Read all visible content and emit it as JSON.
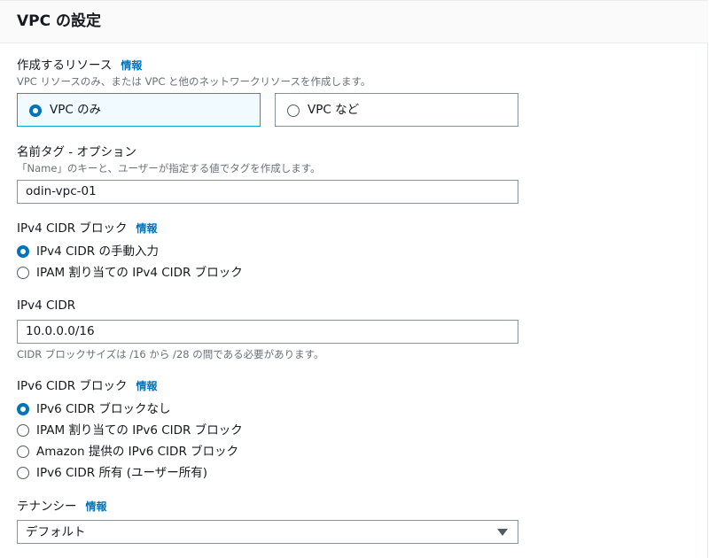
{
  "header": {
    "title": "VPC の設定"
  },
  "resources": {
    "label": "作成するリソース",
    "info": "情報",
    "description": "VPC リソースのみ、または VPC と他のネットワークリソースを作成します。",
    "options": [
      {
        "label": "VPC のみ",
        "selected": true
      },
      {
        "label": "VPC など",
        "selected": false
      }
    ]
  },
  "name_tag": {
    "label": "名前タグ - オプション",
    "description": "「Name」のキーと、ユーザーが指定する値でタグを作成します。",
    "value": "odin-vpc-01"
  },
  "ipv4_block": {
    "label": "IPv4 CIDR ブロック",
    "info": "情報",
    "options": [
      {
        "label": "IPv4 CIDR の手動入力",
        "selected": true
      },
      {
        "label": "IPAM 割り当ての IPv4 CIDR ブロック",
        "selected": false
      }
    ]
  },
  "ipv4_cidr": {
    "label": "IPv4 CIDR",
    "value": "10.0.0.0/16",
    "hint": "CIDR ブロックサイズは /16 から /28 の間である必要があります。"
  },
  "ipv6_block": {
    "label": "IPv6 CIDR ブロック",
    "info": "情報",
    "options": [
      {
        "label": "IPv6 CIDR ブロックなし",
        "selected": true
      },
      {
        "label": "IPAM 割り当ての IPv6 CIDR ブロック",
        "selected": false
      },
      {
        "label": "Amazon 提供の IPv6 CIDR ブロック",
        "selected": false
      },
      {
        "label": "IPv6 CIDR 所有 (ユーザー所有)",
        "selected": false
      }
    ]
  },
  "tenancy": {
    "label": "テナンシー",
    "info": "情報",
    "value": "デフォルト"
  },
  "colors": {
    "accent": "#0073bb",
    "selected_border": "#00a1c9",
    "selected_bg": "#f1faff",
    "text": "#16191f",
    "muted": "#687078",
    "border": "#879596"
  },
  "icons": {
    "dropdown": "caret-down-icon"
  }
}
